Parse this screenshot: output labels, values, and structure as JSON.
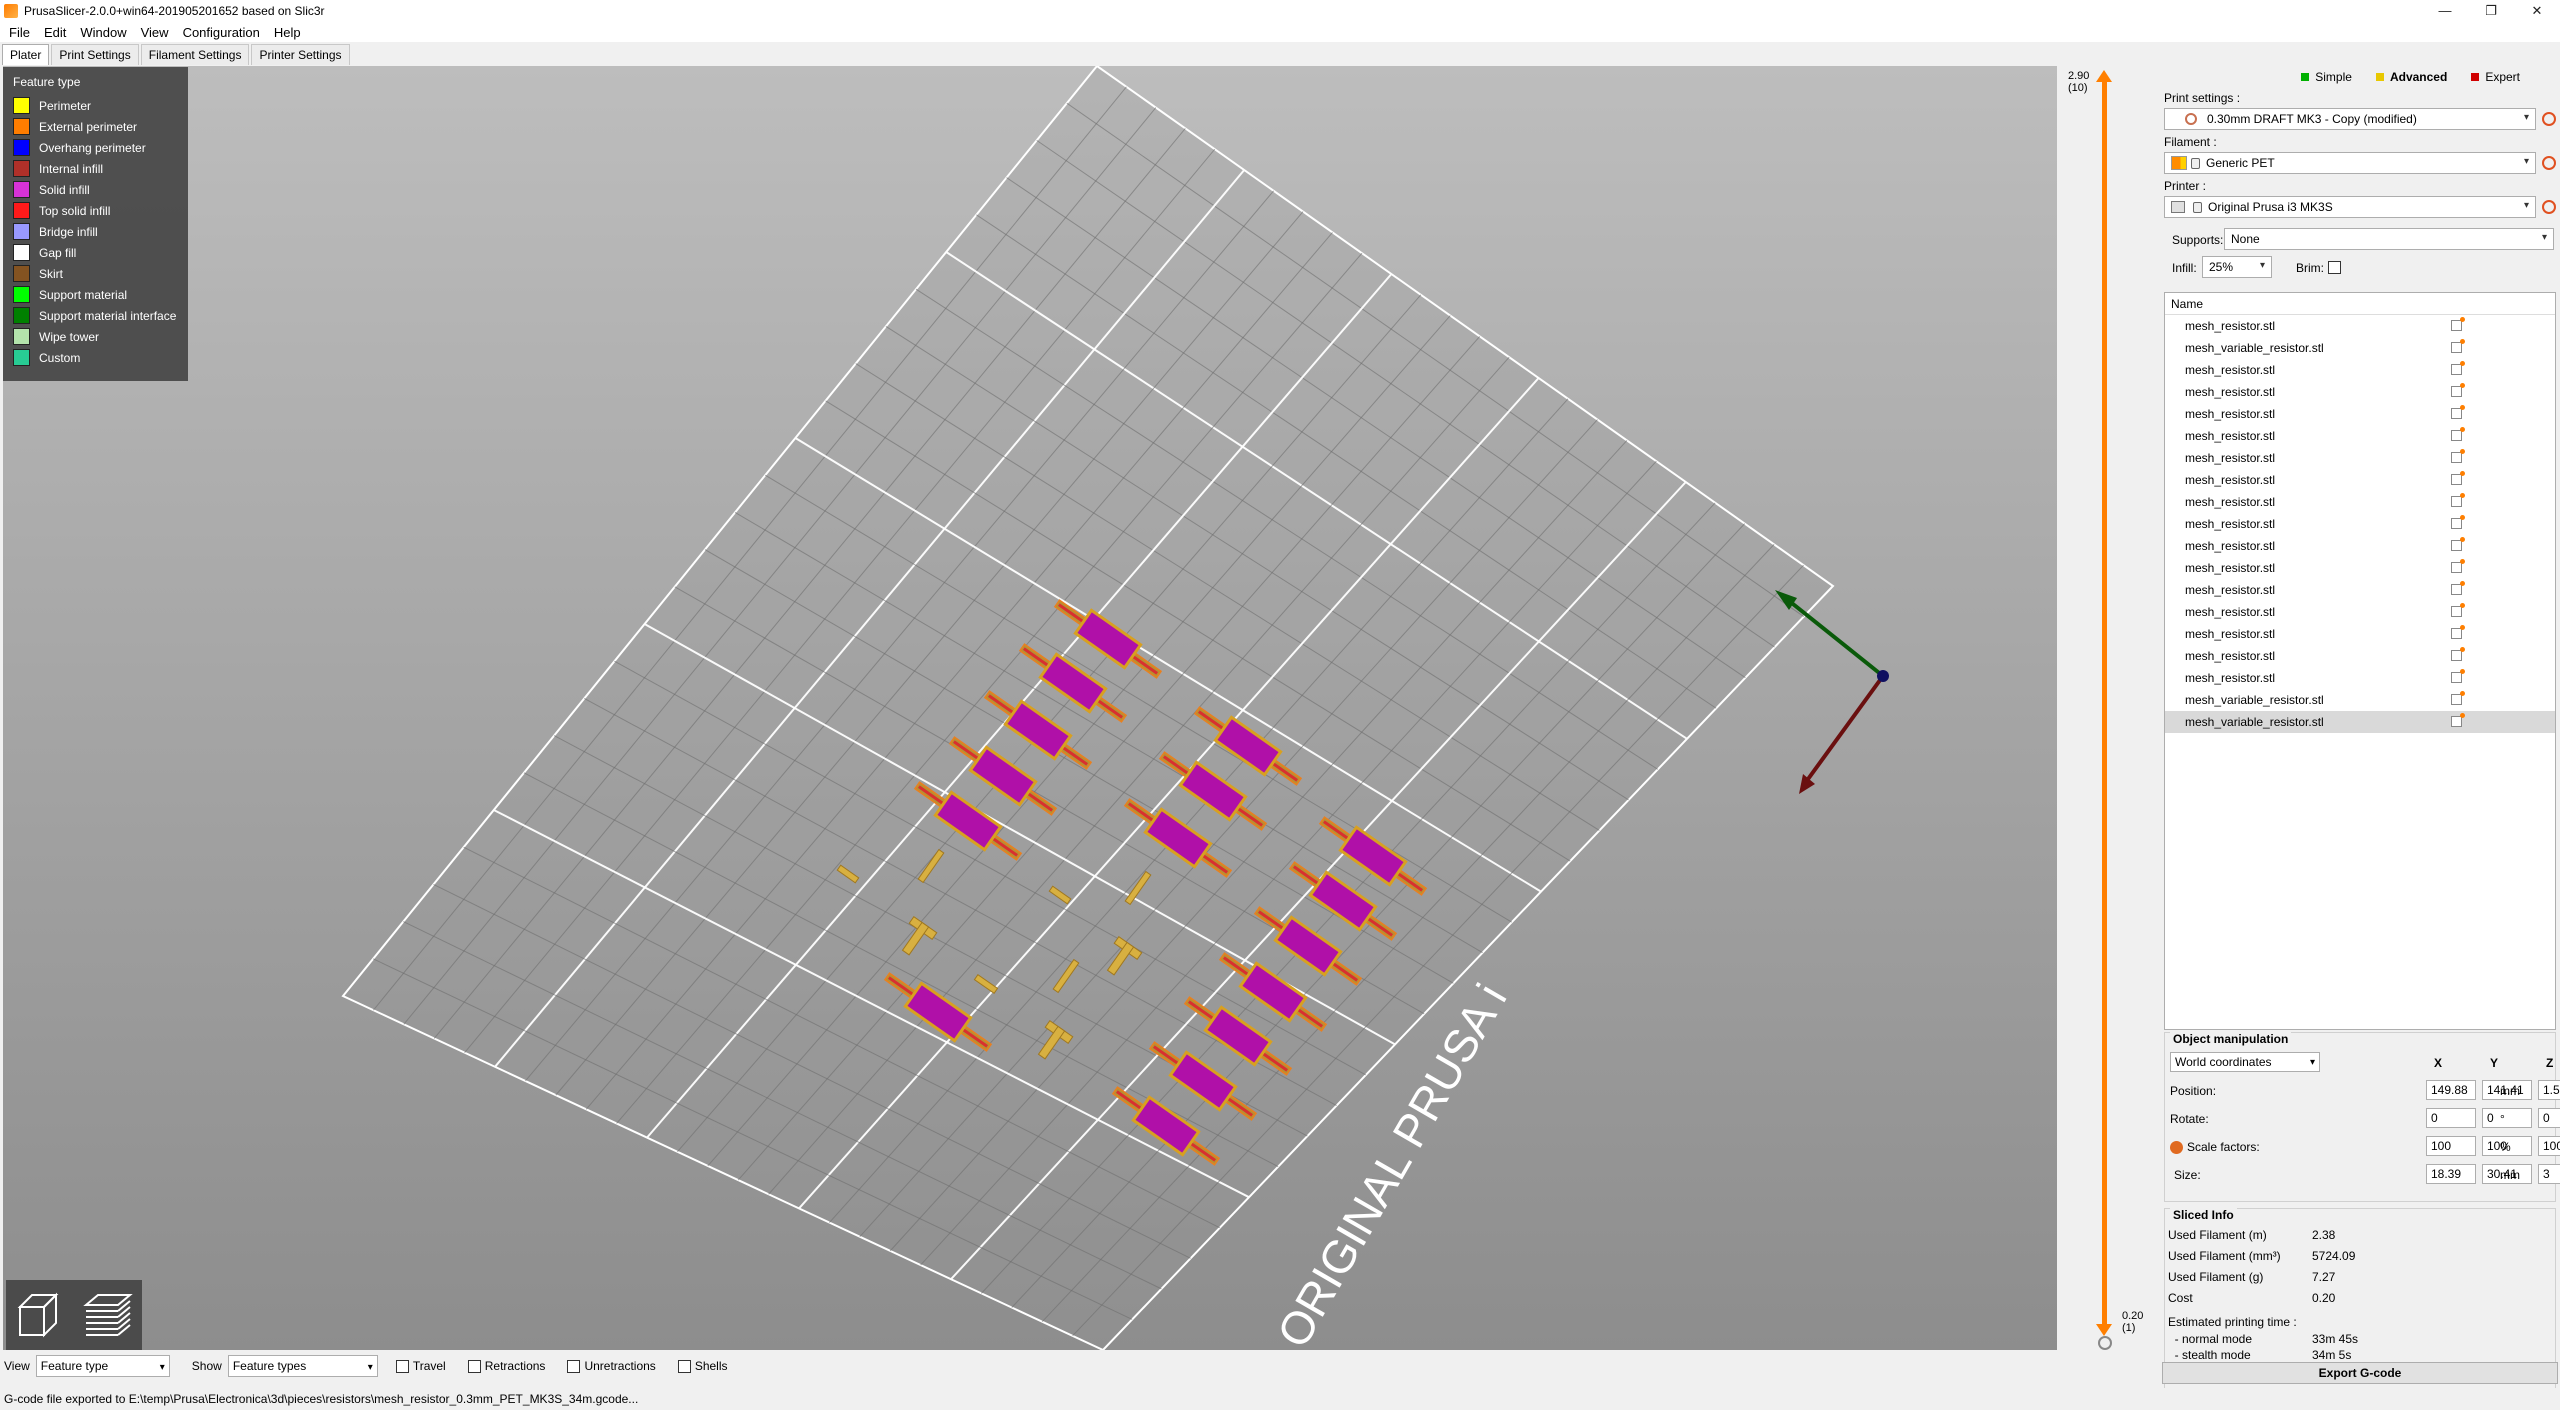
{
  "window": {
    "title": "PrusaSlicer-2.0.0+win64-201905201652 based on Slic3r",
    "minimize": "—",
    "maximize": "❐",
    "close": "✕"
  },
  "menu": [
    "File",
    "Edit",
    "Window",
    "View",
    "Configuration",
    "Help"
  ],
  "tabs": [
    "Plater",
    "Print Settings",
    "Filament Settings",
    "Printer Settings"
  ],
  "legend": {
    "title": "Feature type",
    "items": [
      {
        "label": "Perimeter",
        "color": "#ffff00"
      },
      {
        "label": "External perimeter",
        "color": "#ff7d00"
      },
      {
        "label": "Overhang perimeter",
        "color": "#0000ff"
      },
      {
        "label": "Internal infill",
        "color": "#b03029"
      },
      {
        "label": "Solid infill",
        "color": "#d732d7"
      },
      {
        "label": "Top solid infill",
        "color": "#ff1a1a"
      },
      {
        "label": "Bridge infill",
        "color": "#9999ff"
      },
      {
        "label": "Gap fill",
        "color": "#ffffff"
      },
      {
        "label": "Skirt",
        "color": "#845321"
      },
      {
        "label": "Support material",
        "color": "#00ff00"
      },
      {
        "label": "Support material interface",
        "color": "#008000"
      },
      {
        "label": "Wipe tower",
        "color": "#b3e3ab"
      },
      {
        "label": "Custom",
        "color": "#28cc94"
      }
    ]
  },
  "bed_text": "ORIGINAL PRUSA i",
  "layer_slider": {
    "top_value": "2.90",
    "top_layer": "(10)",
    "bottom_value": "0.20",
    "bottom_layer": "(1)"
  },
  "modes": [
    {
      "label": "Simple",
      "color": "#00b000"
    },
    {
      "label": "Advanced",
      "color": "#e8c800"
    },
    {
      "label": "Expert",
      "color": "#d00000"
    }
  ],
  "print_settings": {
    "label": "Print settings :",
    "value": "0.30mm DRAFT MK3 - Copy (modified)"
  },
  "filament": {
    "label": "Filament :",
    "value": "Generic PET"
  },
  "printer": {
    "label": "Printer :",
    "value": "Original Prusa i3 MK3S"
  },
  "supports": {
    "label": "Supports:",
    "value": "None"
  },
  "infill": {
    "label": "Infill:",
    "value": "25%"
  },
  "brim": {
    "label": "Brim:"
  },
  "object_list": {
    "header": "Name",
    "items": [
      "mesh_resistor.stl",
      "mesh_variable_resistor.stl",
      "mesh_resistor.stl",
      "mesh_resistor.stl",
      "mesh_resistor.stl",
      "mesh_resistor.stl",
      "mesh_resistor.stl",
      "mesh_resistor.stl",
      "mesh_resistor.stl",
      "mesh_resistor.stl",
      "mesh_resistor.stl",
      "mesh_resistor.stl",
      "mesh_resistor.stl",
      "mesh_resistor.stl",
      "mesh_resistor.stl",
      "mesh_resistor.stl",
      "mesh_resistor.stl",
      "mesh_variable_resistor.stl",
      "mesh_variable_resistor.stl"
    ],
    "selected_index": 18
  },
  "object_manipulation": {
    "title": "Object manipulation",
    "coordinates": "World coordinates",
    "axes": [
      "X",
      "Y",
      "Z"
    ],
    "position": {
      "label": "Position:",
      "values": [
        "149.88",
        "141.41",
        "1.5"
      ],
      "unit": "mm"
    },
    "rotate": {
      "label": "Rotate:",
      "values": [
        "0",
        "0",
        "0"
      ],
      "unit": "°"
    },
    "scale": {
      "label": "Scale factors:",
      "values": [
        "100",
        "100",
        "100"
      ],
      "unit": "%"
    },
    "size": {
      "label": "Size:",
      "values": [
        "18.39",
        "30.41",
        "3"
      ],
      "unit": "mm"
    }
  },
  "sliced_info": {
    "title": "Sliced Info",
    "rows": [
      {
        "label": "Used Filament (m)",
        "value": "2.38"
      },
      {
        "label": "Used Filament (mm³)",
        "value": "5724.09"
      },
      {
        "label": "Used Filament (g)",
        "value": "7.27"
      },
      {
        "label": "Cost",
        "value": "0.20"
      },
      {
        "label": "Estimated printing time :",
        "value": ""
      },
      {
        "label": "  - normal mode",
        "value": "33m 45s"
      },
      {
        "label": "  - stealth mode",
        "value": "34m 5s"
      }
    ]
  },
  "export_button": "Export G-code",
  "bottom": {
    "view_label": "View",
    "view_value": "Feature type",
    "show_label": "Show",
    "show_value": "Feature types",
    "checks": [
      "Travel",
      "Retractions",
      "Unretractions",
      "Shells"
    ]
  },
  "status": "G-code file exported to E:\\temp\\Prusa\\Electronica\\3d\\pieces\\resistors\\mesh_resistor_0.3mm_PET_MK3S_34m.gcode..."
}
